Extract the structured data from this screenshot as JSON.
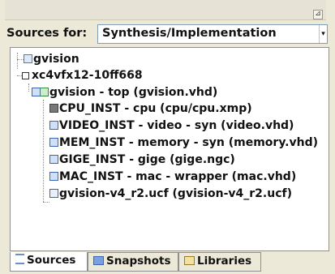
{
  "toolbar": {
    "corner_glyph": "⊿"
  },
  "sources_for": {
    "label": "Sources for:",
    "value": "Synthesis/Implementation",
    "dropdown_glyph": "▾"
  },
  "tree": {
    "project": "gvision",
    "device": "xc4vfx12-10ff668",
    "top": "gvision - top (gvision.vhd)",
    "children": [
      "CPU_INST - cpu (cpu/cpu.xmp)",
      "VIDEO_INST - video - syn (video.vhd)",
      "MEM_INST - memory - syn (memory.vhd)",
      "GIGE_INST - gige (gige.ngc)",
      "MAC_INST - mac - wrapper (mac.vhd)",
      "gvision-v4_r2.ucf (gvision-v4_r2.ucf)"
    ]
  },
  "tabs": [
    "Sources",
    "Snapshots",
    "Libraries"
  ],
  "colors": {
    "panel_bg": "#ffffff",
    "frame_bg": "#ece9d8",
    "vhd_icon": "#3a66b5",
    "top_icon": "#2f8a3a"
  }
}
